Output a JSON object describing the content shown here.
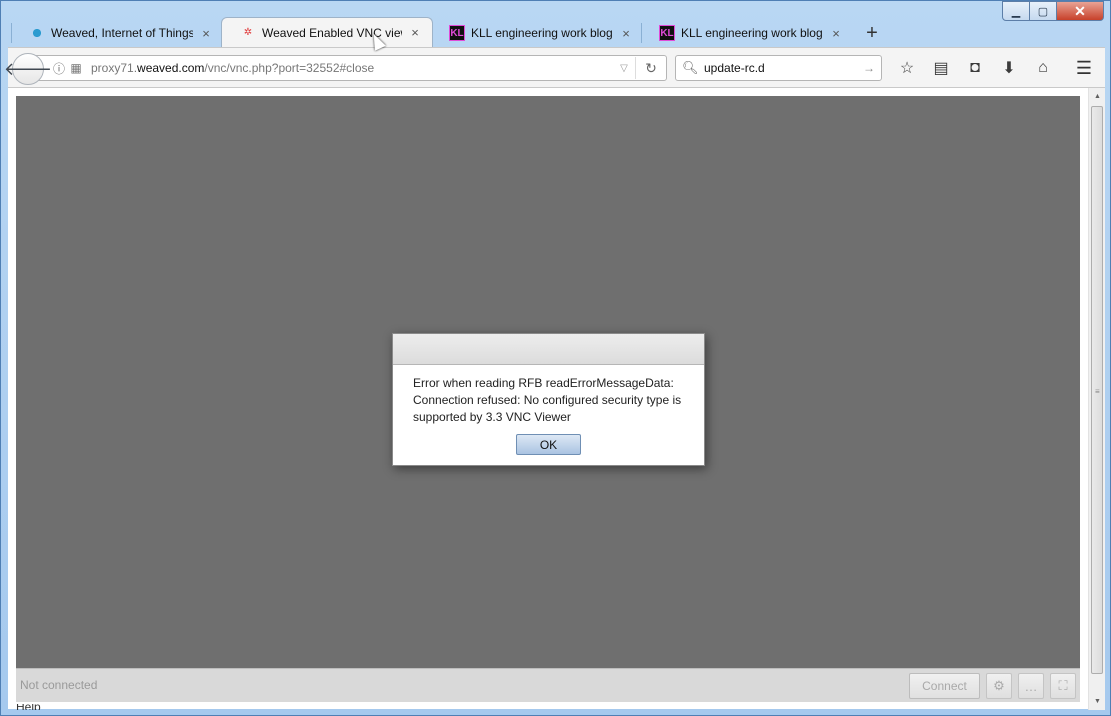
{
  "window": {
    "minimize_glyph": "▁",
    "maximize_glyph": "▢",
    "close_glyph": "✕"
  },
  "tabs": [
    {
      "label": "Weaved, Internet of Things...",
      "icon": "weaved-icon",
      "active": false
    },
    {
      "label": "Weaved Enabled VNC view...",
      "icon": "vnc-icon",
      "active": true
    },
    {
      "label": "KLL engineering work blog...",
      "icon": "kll-icon",
      "active": false
    },
    {
      "label": "KLL engineering work blog...",
      "icon": "kll-icon",
      "active": false
    }
  ],
  "tab_close_glyph": "×",
  "new_tab_glyph": "+",
  "kll_icon_text": "KL",
  "navbar": {
    "url_prefix": "proxy71.",
    "url_host": "weaved.com",
    "url_path": "/vnc/vnc.php?port=32552#close",
    "search_value": "update-rc.d"
  },
  "vnc": {
    "status": "Not connected",
    "connect_label": "Connect",
    "overflow_text": "Help"
  },
  "dialog": {
    "message_line1": "Error when reading RFB readErrorMessageData:",
    "message_line2": "Connection refused: No configured security type is",
    "message_line3": "supported by 3.3 VNC Viewer",
    "ok_label": "OK"
  },
  "colors": {
    "vnc_canvas": "#6f6f6f",
    "window_frame": "#a5c9ee",
    "close_button": "#c7412a"
  }
}
